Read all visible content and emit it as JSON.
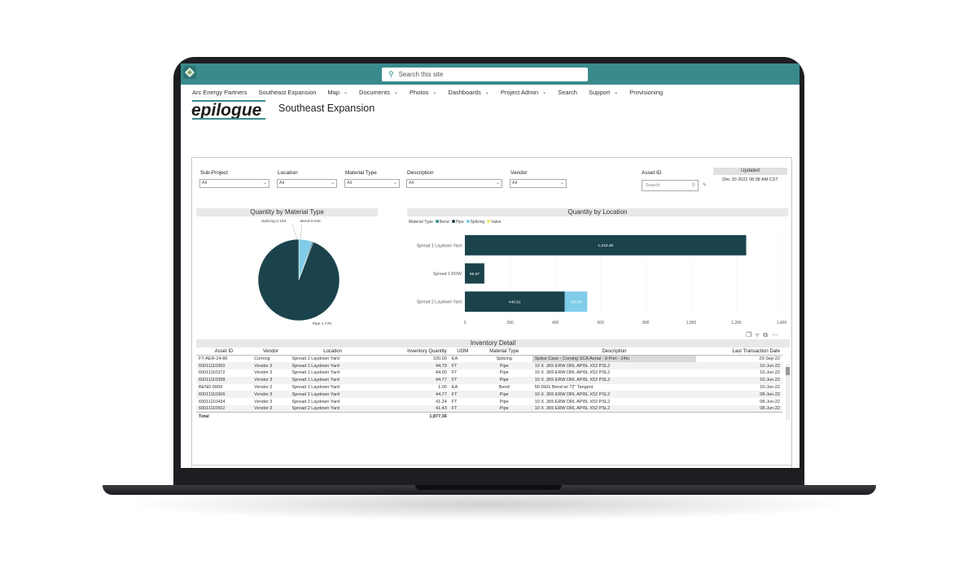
{
  "site": {
    "search_placeholder": "Search this site",
    "title": "Southeast Expansion",
    "brand": "epilogue"
  },
  "nav": [
    {
      "label": "Arc Energy Partners",
      "dropdown": false
    },
    {
      "label": "Southeast Expansion",
      "dropdown": false
    },
    {
      "label": "Map",
      "dropdown": true
    },
    {
      "label": "Documents",
      "dropdown": true
    },
    {
      "label": "Photos",
      "dropdown": true
    },
    {
      "label": "Dashboards",
      "dropdown": true
    },
    {
      "label": "Project Admin",
      "dropdown": true
    },
    {
      "label": "Search",
      "dropdown": false
    },
    {
      "label": "Support",
      "dropdown": true
    },
    {
      "label": "Provisioning",
      "dropdown": false
    }
  ],
  "filters": {
    "subproject": {
      "label": "Sub-Project",
      "value": "All"
    },
    "location": {
      "label": "Location",
      "value": "All"
    },
    "material": {
      "label": "Material Type",
      "value": "All"
    },
    "description": {
      "label": "Description",
      "value": "All"
    },
    "vendor": {
      "label": "Vendor",
      "value": "All"
    },
    "asset_id": {
      "label": "Asset ID",
      "placeholder": "Search"
    }
  },
  "updated": {
    "label": "Updated",
    "value": "Dec 30 2022 08:38 AM CST"
  },
  "colors": {
    "bend": "#1b434c",
    "pipe": "#1b434c",
    "splicing": "#7fcde8",
    "valve": "#f0e66a",
    "teal": "#3a8a8c"
  },
  "pie_panel": {
    "title": "Quantity by Material Type",
    "legend_label_splicing": "Splicing 0.10K",
    "legend_label_bend": "Bend 0.01K",
    "legend_label_pipe": "Pipe 1.77K"
  },
  "bar_panel": {
    "title": "Quantity by Location",
    "legend_title": "Material Type",
    "legend": [
      "Bend",
      "Pipe",
      "Splicing",
      "Valve"
    ]
  },
  "chart_data": [
    {
      "type": "pie",
      "title": "Quantity by Material Type",
      "slices": [
        {
          "name": "Pipe",
          "value": 1770,
          "label": "Pipe 1.77K"
        },
        {
          "name": "Splicing",
          "value": 100,
          "label": "Splicing 0.10K"
        },
        {
          "name": "Bend",
          "value": 10,
          "label": "Bend 0.01K"
        }
      ]
    },
    {
      "type": "bar",
      "orientation": "horizontal",
      "stacked": true,
      "title": "Quantity by Location",
      "categories": [
        "Spread 1 Laydown Yard",
        "Spread 1 ROW",
        "Spread 2 Laydown Yard"
      ],
      "series": [
        {
          "name": "Pipe",
          "values": [
            1243.48,
            85.97,
            440.91
          ],
          "labels": [
            "1,243.48",
            "85.97",
            "440.91"
          ]
        },
        {
          "name": "Splicing",
          "values": [
            0,
            0,
            100
          ],
          "labels": [
            "",
            "",
            "100.00"
          ]
        }
      ],
      "xticks": [
        "0",
        "200",
        "400",
        "600",
        "800",
        "1,000",
        "1,200",
        "1,400"
      ],
      "xlim": [
        0,
        1400
      ],
      "grid": true,
      "legend": "top-left"
    }
  ],
  "table": {
    "title": "Inventory Detail",
    "columns": [
      "Asset ID",
      "Vendor",
      "Location",
      "Inventory Quantity",
      "UOM",
      "Material Type",
      "Description",
      "Last Transaction Date"
    ],
    "rows": [
      [
        "FT-AER-24-86",
        "Corning",
        "Spread 2 Laydown Yard",
        "100.00",
        "EA",
        "Splicing",
        "Splice Case - Corning SCA Aerial - 8 Port - 24in",
        "23-Sep-22"
      ],
      [
        "60011110360",
        "Vendor 3",
        "Spread 1 Laydown Yard",
        "44.79",
        "FT",
        "Pipe",
        "10 X .365 ERW DRL API5L X52 PSL2",
        "10-Jun-22"
      ],
      [
        "60011110372",
        "Vendor 3",
        "Spread 1 Laydown Yard",
        "44.00",
        "FT",
        "Pipe",
        "10 X .365 ERW DRL API5L X52 PSL2",
        "10-Jun-22"
      ],
      [
        "60011110398",
        "Vendor 3",
        "Spread 1 Laydown Yard",
        "44.77",
        "FT",
        "Pipe",
        "10 X .365 ERW DRL API5L X52 PSL2",
        "10-Jun-22"
      ],
      [
        "BEND 0009",
        "Vendor 2",
        "Spread 1 Laydown Yard",
        "1.00",
        "EA",
        "Bend",
        "50 DEG Bend w/ 72\" Tangent",
        "10-Jun-22"
      ],
      [
        "60011110366",
        "Vendor 3",
        "Spread 2 Laydown Yard",
        "44.77",
        "FT",
        "Pipe",
        "10 X .365 ERW DRL API5L X52 PSL2",
        "08-Jun-22"
      ],
      [
        "60011110434",
        "Vendor 3",
        "Spread 2 Laydown Yard",
        "41.24",
        "FT",
        "Pipe",
        "10 X .365 ERW DRL API5L X52 PSL2",
        "08-Jun-22"
      ],
      [
        "60011110502",
        "Vendor 3",
        "Spread 2 Laydown Yard",
        "41.43",
        "FT",
        "Pipe",
        "10 X .365 ERW DRL API5L X52 PSL2",
        "08-Jun-22"
      ]
    ],
    "total_label": "Total",
    "total_value": "1,877.36"
  }
}
